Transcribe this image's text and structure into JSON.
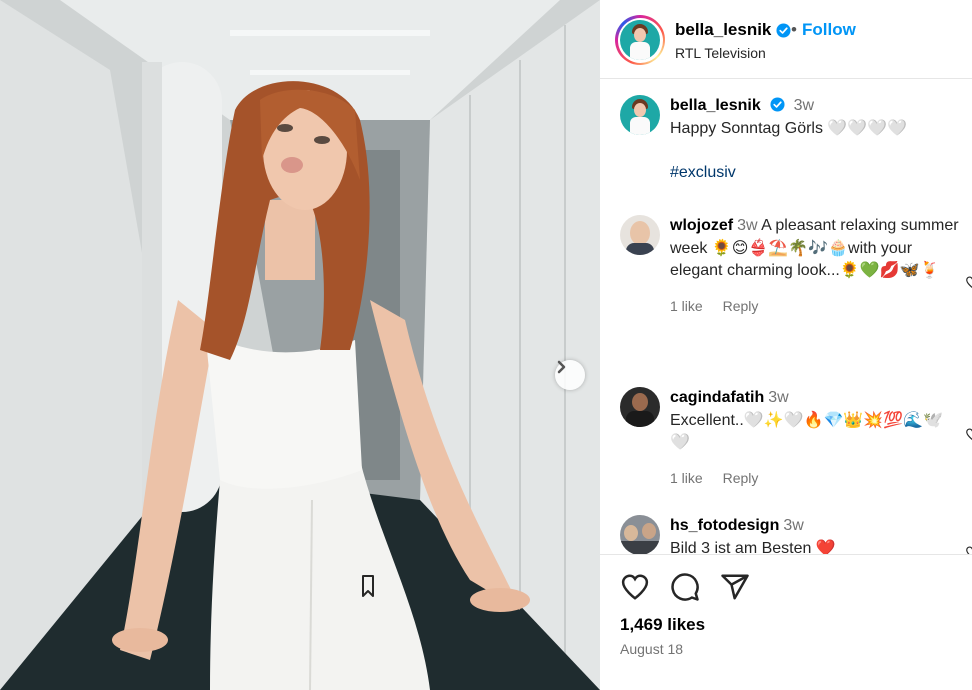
{
  "post": {
    "username": "bella_lesnik",
    "subtitle": "RTL Television",
    "follow_label": "Follow",
    "separator": "•",
    "caption_time": "3w",
    "caption_line1": "Happy Sonntag Görls 🤍🤍🤍🤍",
    "caption_tag": "#exclusiv",
    "likes": "1,469 likes",
    "date": "August 18"
  },
  "comments": [
    {
      "username": "wlojozef",
      "time": "3w",
      "text": "A pleasant relaxing summer week 🌻😊👙⛱️🌴🎶🧁with your elegant charming look...🌻💚💋🦋🍹",
      "likes": "1 like",
      "reply": "Reply"
    },
    {
      "username": "cagindafatih",
      "time": "3w",
      "text": "Excellent..🤍✨🤍🔥💎👑💥💯🌊🕊️🤍",
      "likes": "1 like",
      "reply": "Reply"
    },
    {
      "username": "hs_fotodesign",
      "time": "3w",
      "text": "Bild 3 ist am Besten ❤️"
    }
  ],
  "colors": {
    "accent": "#0095f6",
    "hashtag": "#00376b",
    "muted": "#737373"
  },
  "icons": [
    "verified-badge-icon",
    "next-arrow-icon",
    "heart-icon",
    "comment-icon",
    "share-icon",
    "bookmark-icon"
  ]
}
